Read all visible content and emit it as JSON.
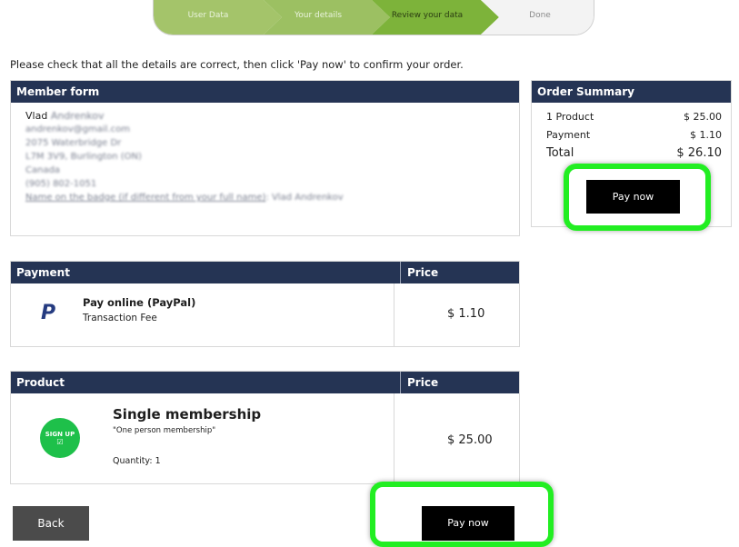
{
  "stepper": {
    "steps": [
      "User Data",
      "Your details",
      "Review your data",
      "Done"
    ],
    "active_index": 2
  },
  "intro": "Please check that all the details are correct, then click 'Pay now' to confirm your order.",
  "member_form": {
    "title": "Member form",
    "name": "Vlad",
    "name_blurred": "Andrenkov",
    "email": "andrenkov@gmail.com",
    "street": "2075 Waterbridge Dr",
    "city": "L7M 3V9, Burlington (ON)",
    "country": "Canada",
    "phone": "(905) 802-1051",
    "badge_name_label": "Name on the badge (if different from your full name)",
    "badge_name_value": "Vlad Andrenkov"
  },
  "order_summary": {
    "title": "Order Summary",
    "rows": [
      {
        "label": "1 Product",
        "value": "$ 25.00"
      },
      {
        "label": "Payment",
        "value": "$ 1.10"
      }
    ],
    "total_label": "Total",
    "total_value": "$ 26.10",
    "pay_button": "Pay now"
  },
  "payment_table": {
    "header_left": "Payment",
    "header_right": "Price",
    "method_title": "Pay online (PayPal)",
    "method_sub": "Transaction Fee",
    "icon_glyph": "P",
    "price": "$ 1.10"
  },
  "product_table": {
    "header_left": "Product",
    "header_right": "Price",
    "badge_text": "SIGN UP",
    "badge_check": "☑",
    "title": "Single membership",
    "subtitle": "\"One person membership\"",
    "quantity": "Quantity: 1",
    "price": "$ 25.00"
  },
  "footer": {
    "back_button": "Back",
    "pay_button": "Pay now"
  },
  "colors": {
    "header_navy": "#253454",
    "step_green_light": "#a4c46a",
    "step_green_active": "#7db33a",
    "highlight_green": "#22ee22"
  }
}
